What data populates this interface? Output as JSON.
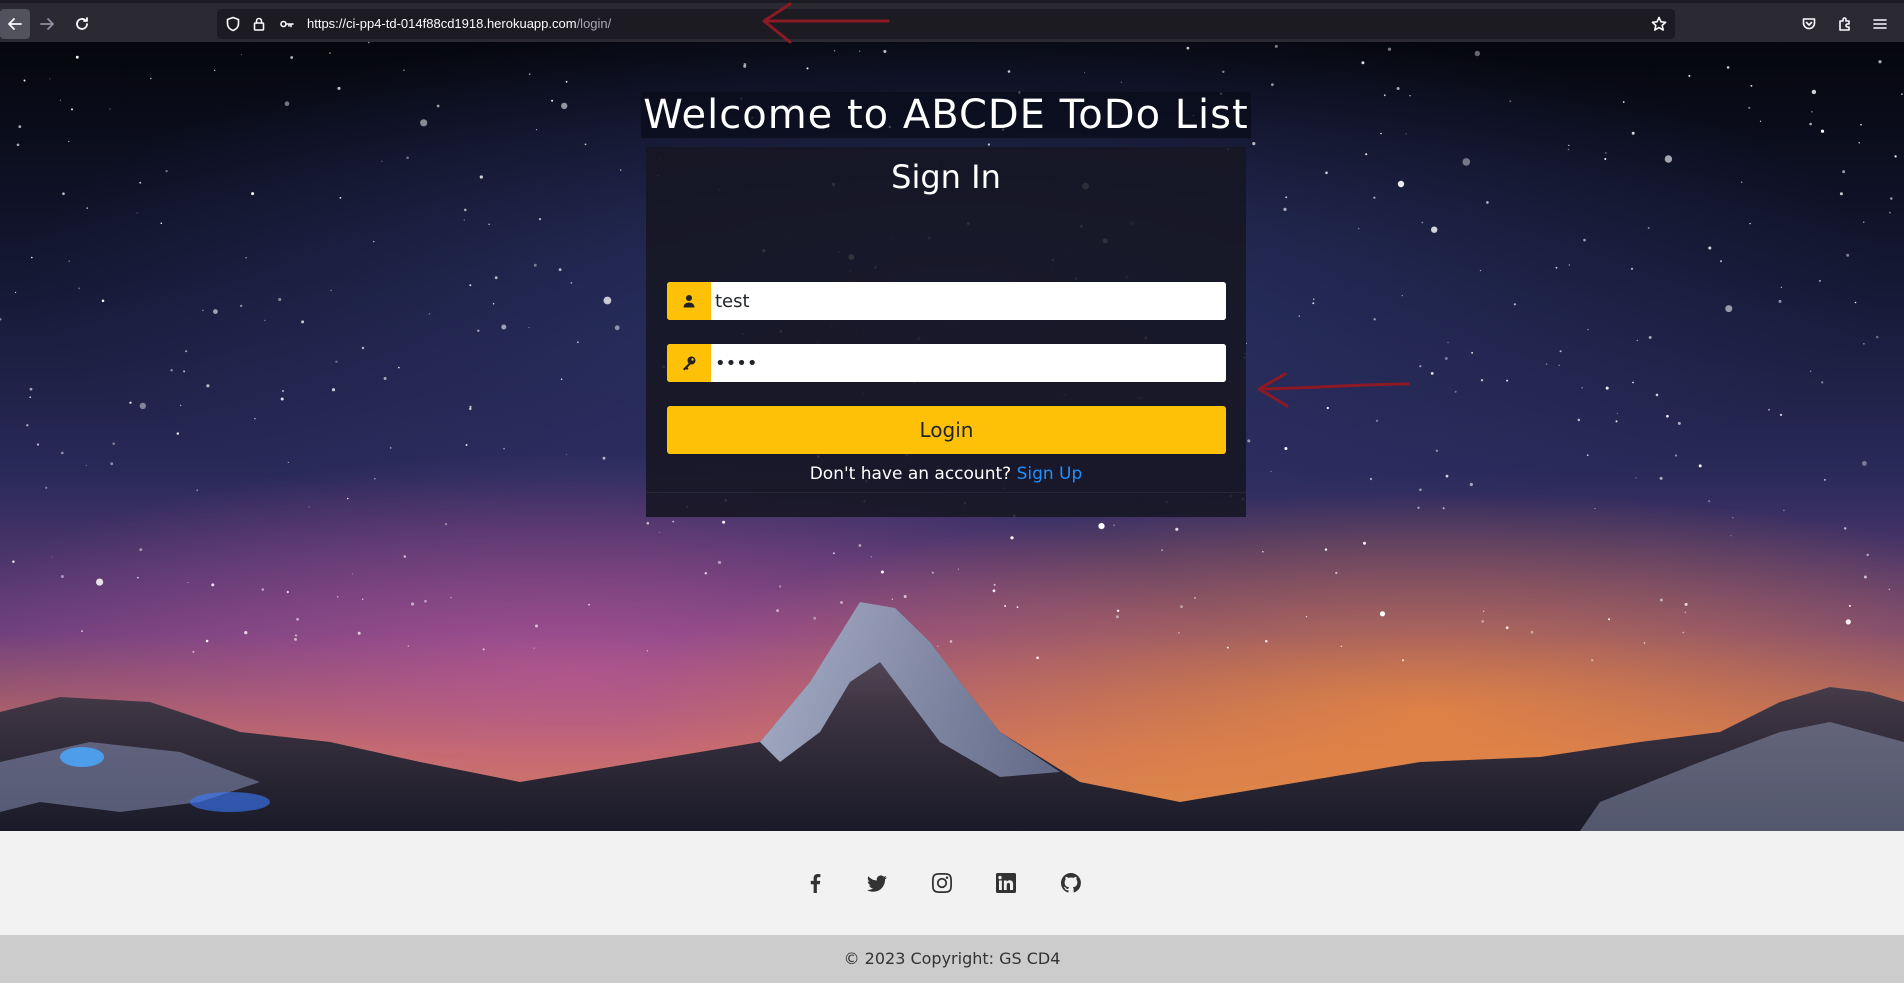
{
  "browser": {
    "url_host": "https://ci-pp4-td-014f88cd1918.herokuapp.com",
    "url_path": "/login/",
    "icons": [
      "back-icon",
      "forward-icon",
      "reload-icon",
      "shield-icon",
      "lock-icon",
      "key-icon",
      "star-icon",
      "pocket-icon",
      "extensions-icon",
      "menu-icon"
    ]
  },
  "page": {
    "welcome_title": "Welcome to ABCDE ToDo List"
  },
  "login_form": {
    "title": "Sign In",
    "username_value": "test",
    "password_value": "test",
    "submit_label": "Login",
    "signup_prompt": "Don't have an account?",
    "signup_link": "Sign Up"
  },
  "colors": {
    "accent": "#ffc107",
    "link": "#1e90ff",
    "annotation_arrow": "#8b1a24"
  },
  "footer": {
    "social_icons": [
      "facebook-icon",
      "twitter-icon",
      "instagram-icon",
      "linkedin-icon",
      "github-icon"
    ],
    "copyright": "© 2023 Copyright: GS CD4"
  }
}
